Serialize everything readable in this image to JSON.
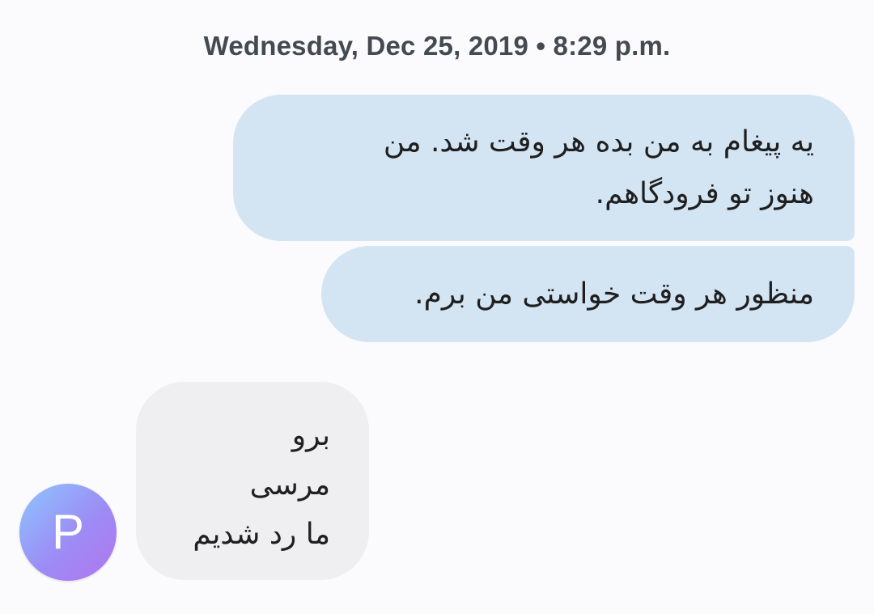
{
  "conversation": {
    "timestamp": "Wednesday, Dec 25, 2019 • 8:29 p.m.",
    "outgoing": [
      {
        "lines": [
          "یه پیغام به من بده هر وقت شد. من",
          "هنوز تو فرودگاهم."
        ]
      },
      {
        "lines": [
          "منظور هر وقت خواستی من برم."
        ]
      }
    ],
    "incoming": [
      {
        "sender_initial": "P",
        "lines": [
          "برو",
          "مرسی",
          "ما رد شدیم"
        ]
      }
    ]
  },
  "colors": {
    "background": "#fbfbfd",
    "outgoing_bubble": "#d3e4f3",
    "incoming_bubble": "#efeff1",
    "timestamp_text": "#444a52",
    "message_text": "#1f1f1f",
    "avatar_gradient": [
      "#8cc6ff",
      "#9d8cf5",
      "#b175ee"
    ]
  }
}
